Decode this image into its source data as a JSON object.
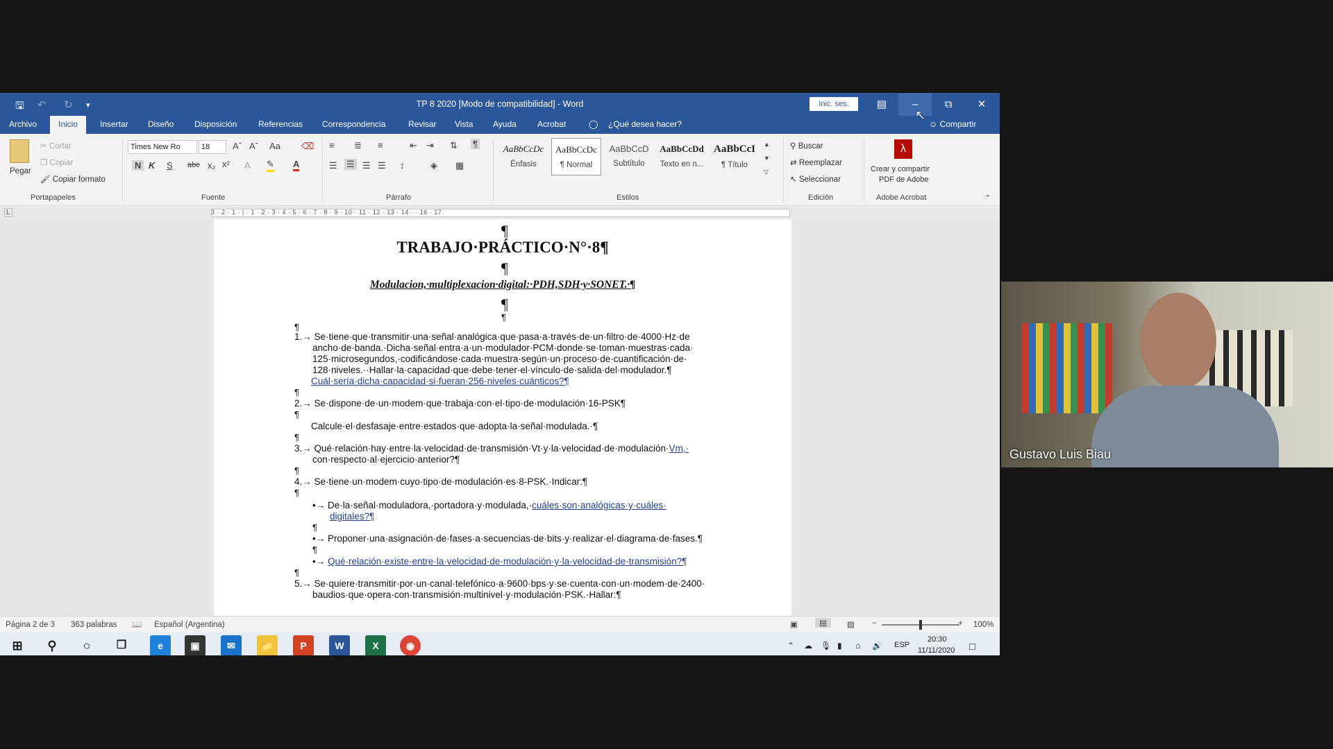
{
  "window": {
    "title": "TP 8 2020 [Modo de compatibilidad]  -  Word",
    "sign_in": "Inic. ses.",
    "share": "Compartir",
    "tell_me": "¿Qué desea hacer?"
  },
  "tabs": [
    "Archivo",
    "Inicio",
    "Insertar",
    "Diseño",
    "Disposición",
    "Referencias",
    "Correspondencia",
    "Revisar",
    "Vista",
    "Ayuda",
    "Acrobat"
  ],
  "ribbon": {
    "clipboard": {
      "paste": "Pegar",
      "cut": "Cortar",
      "copy": "Copiar",
      "format_painter": "Copiar formato",
      "group": "Portapapeles"
    },
    "font": {
      "family": "Times New Ro",
      "size": "18",
      "bold": "N",
      "italic": "K",
      "underline": "S",
      "strike": "abc",
      "group": "Fuente"
    },
    "paragraph": {
      "group": "Párrafo"
    },
    "styles": {
      "items": [
        {
          "preview": "AaBbCcDc",
          "name": "Énfasis"
        },
        {
          "preview": "AaBbCcDc",
          "name": "¶ Normal"
        },
        {
          "preview": "AaBbCcD",
          "name": "Subtítulo"
        },
        {
          "preview": "AaBbCcDd",
          "name": "Texto en n..."
        },
        {
          "preview": "AaBbCcI",
          "name": "¶ Título"
        }
      ],
      "group": "Estilos"
    },
    "editing": {
      "find": "Buscar",
      "replace": "Reemplazar",
      "select": "Seleccionar",
      "group": "Edición"
    },
    "acrobat": {
      "create": "Crear y compartir",
      "create2": "PDF de Adobe",
      "group": "Adobe Acrobat"
    }
  },
  "ruler": "3 · 2 · 1 · | · 1 · 2 · 3 · 4 · 5 · 6 · 7 · 8 · 9 · 10 · 11 · 12 · 13 · 14 · · 16 · 17",
  "document": {
    "title": "TRABAJO·PRÁCTICO·N°·8¶",
    "subtitle": "Modulacion,·multiplexacion·digital:·PDH,SDH·y·SONET.·¶",
    "q1": [
      "1.→ Se·tiene·que·transmitir·una·señal·analógica·que·pasa·a·través·de·un·filtro·de·4000·Hz·de",
      "ancho·de·banda.·Dicha·señal·entra·a·un·modulador·PCM·donde·se·toman·muestras·cada·",
      "125·microsegundos,·codificándose·cada·muestra·según·un·proceso·de·cuantificación·de·",
      "128·niveles.··Hallar·la·capacidad·que·debe·tener·el·vínculo·de·salida·del·modulador.¶"
    ],
    "q1b": "Cuál·sería·dicha·capacidad·si·fueran·256·niveles·cuánticos?¶",
    "q2": "2.→ Se·dispone·de·un·modem·que·trabaja·con·el·tipo·de·modulación·16-PSK¶",
    "q2b": "Calcule·el·desfasaje·entre·estados·que·adopta·la·señal·modulada.·¶",
    "q3a": "3.→ Qué·relación·hay·entre·la·velocidad·de·transmisión·Vt·y·la·velocidad·de·modulación·",
    "q3a_link": "Vm,·",
    "q3b": "con·respecto·al·ejercicio·anterior?¶",
    "q4": "4.→ Se·tiene·un·modem·cuyo·tipo·de·modulación·es·8-PSK.·Indicar:¶",
    "b1a": "•→ De·la·señal·moduladora,·portadora·y·modulada,·",
    "b1a_link": "cuáles·son·analógicas·y·cuáles·",
    "b1b": "digitales?¶",
    "b2": "•→ Proponer·una·asignación·de·fases·a·secuencias·de·bits·y·realizar·el·diagrama·de·fases.¶",
    "b3": "Qué·relación·existe·entre·la·velocidad·de·modulación·y·la·velocidad·de·transmisión?¶",
    "q5a": "5.→ Se·quiere·transmitir·por·un·canal·telefónico·a·9600·bps·y·se·cuenta·con·un·modem·de·2400·",
    "q5b": "baudios·que·opera·con·transmisión·multinivel·y·modulación·PSK.·Hallar:¶",
    "pilcrow": "¶"
  },
  "status": {
    "page": "Página 2 de 3",
    "words": "363 palabras",
    "language": "Español (Argentina)",
    "zoom": "100%",
    "zoom_level": 1.0
  },
  "taskbar": {
    "lang": "ESP",
    "time": "20:30",
    "date": "11/11/2020"
  },
  "video": {
    "participant": "Gustavo Luis Biau"
  },
  "colors": {
    "word_blue": "#2b579a",
    "link": "#1f3f8f"
  }
}
